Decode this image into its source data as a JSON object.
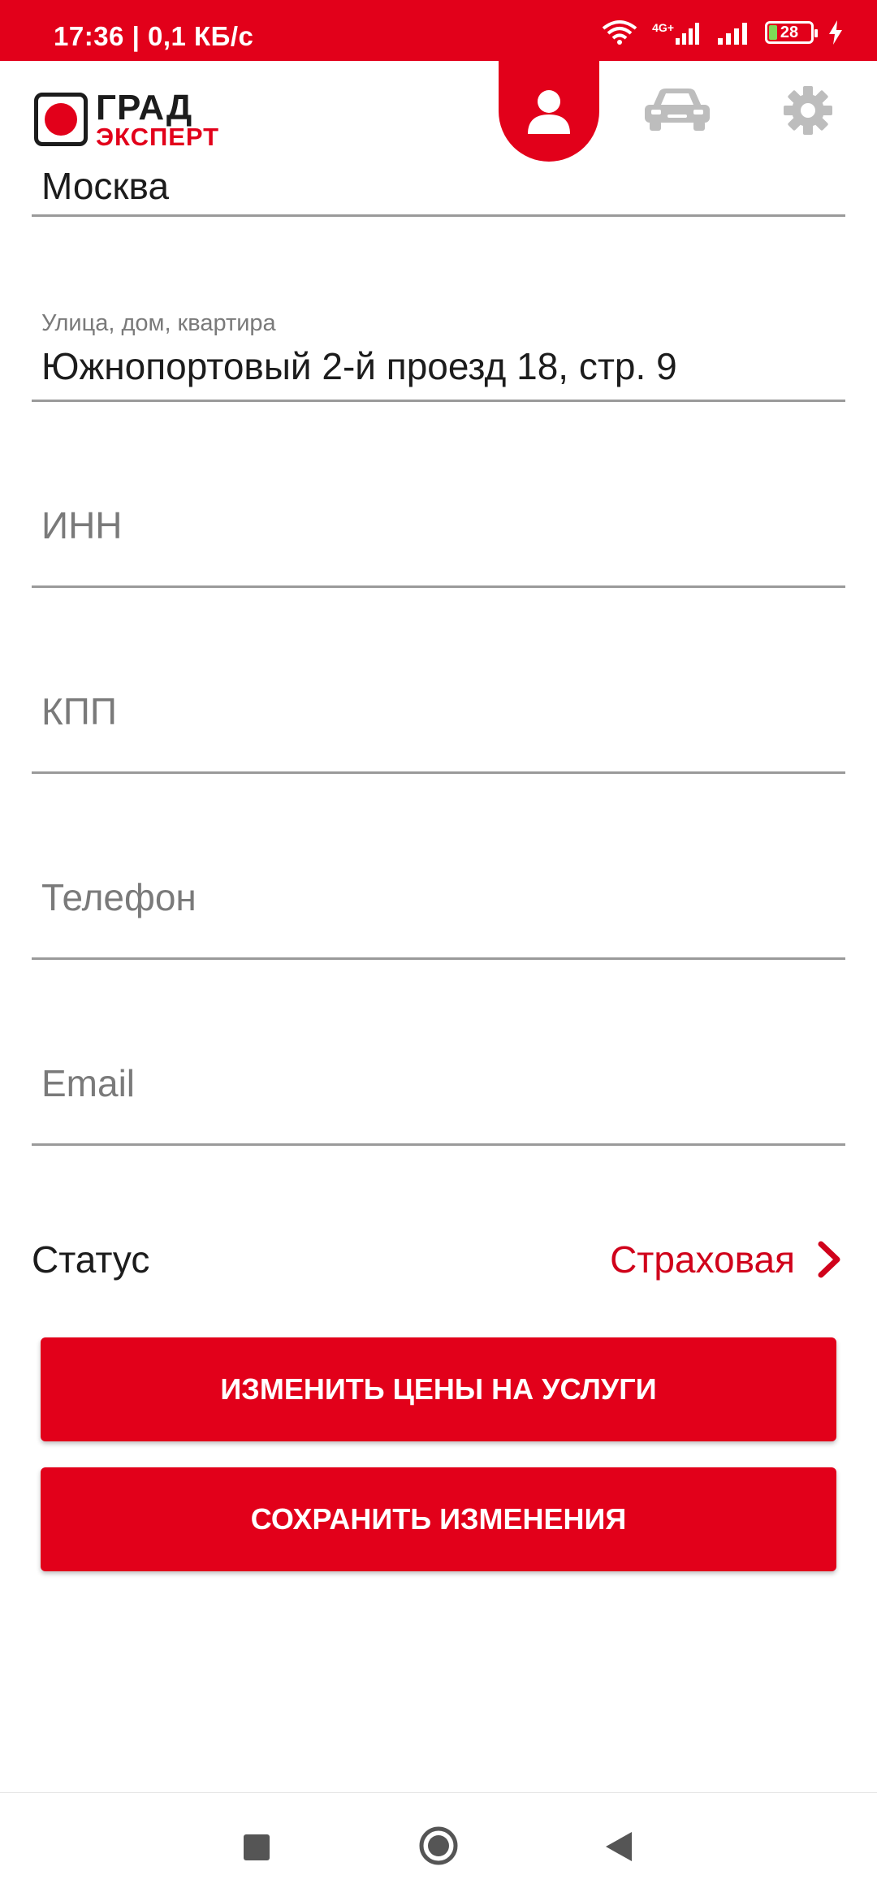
{
  "status_bar": {
    "time_speed": "17:36 | 0,1 КБ/с",
    "network": "4G+",
    "battery": "28"
  },
  "header": {
    "logo_line1": "ГРАД",
    "logo_line2": "ЭКСПЕРТ",
    "tabs": [
      {
        "icon": "user-icon",
        "active": true
      },
      {
        "icon": "car-icon",
        "active": false
      },
      {
        "icon": "gear-icon",
        "active": false
      }
    ]
  },
  "form": {
    "city_value": "Москва",
    "address_label": "Улица, дом, квартира",
    "address_value": "Южнопортовый 2-й проезд 18, стр. 9",
    "inn_placeholder": "ИНН",
    "kpp_placeholder": "КПП",
    "phone_placeholder": "Телефон",
    "email_placeholder": "Email"
  },
  "status": {
    "label": "Статус",
    "value": "Страховая"
  },
  "buttons": {
    "change_prices": "ИЗМЕНИТЬ ЦЕНЫ НА УСЛУГИ",
    "save": "СОХРАНИТЬ ИЗМЕНЕНИЯ"
  },
  "colors": {
    "brand_red": "#e2001a",
    "text_dark": "#1c1c1c",
    "placeholder_gray": "#7a7a7a",
    "icon_gray": "#bdbdbd"
  },
  "nav": {
    "icons": [
      "recents-icon",
      "home-icon",
      "back-icon"
    ]
  }
}
